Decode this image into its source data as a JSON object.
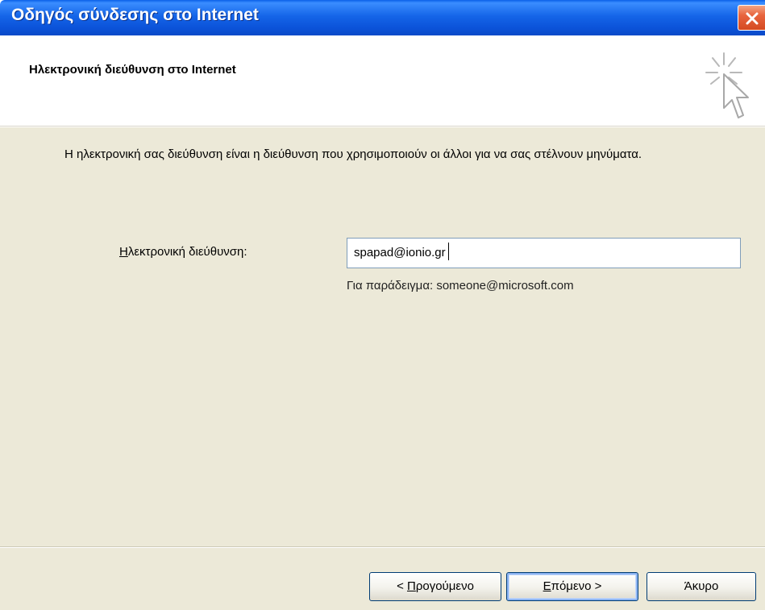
{
  "window": {
    "title": "Οδηγός σύνδεσης στο Internet"
  },
  "header": {
    "title": "Ηλεκτρονική διεύθυνση στο Internet",
    "icon": "wizard-sparkle-cursor-icon"
  },
  "main": {
    "description": "Η ηλεκτρονική σας διεύθυνση είναι η διεύθυνση που χρησιμοποιούν οι άλλοι για να σας στέλνουν μηνύματα.",
    "email_label_accel": "Η",
    "email_label_rest": "λεκτρονική διεύθυνση:",
    "email_value": "spapad@ionio.gr",
    "example_text": "Για παράδειγμα: someone@microsoft.com"
  },
  "buttons": {
    "back_prefix": "< ",
    "back_accel": "Π",
    "back_rest": "ρογούμενο",
    "next_accel": "Ε",
    "next_rest": "πόμενο >",
    "cancel": "Άκυρο"
  },
  "colors": {
    "titlebar": "#0b52d8",
    "close_button": "#e8643e",
    "dialog_body": "#ece9d8",
    "button_border": "#003c74"
  }
}
